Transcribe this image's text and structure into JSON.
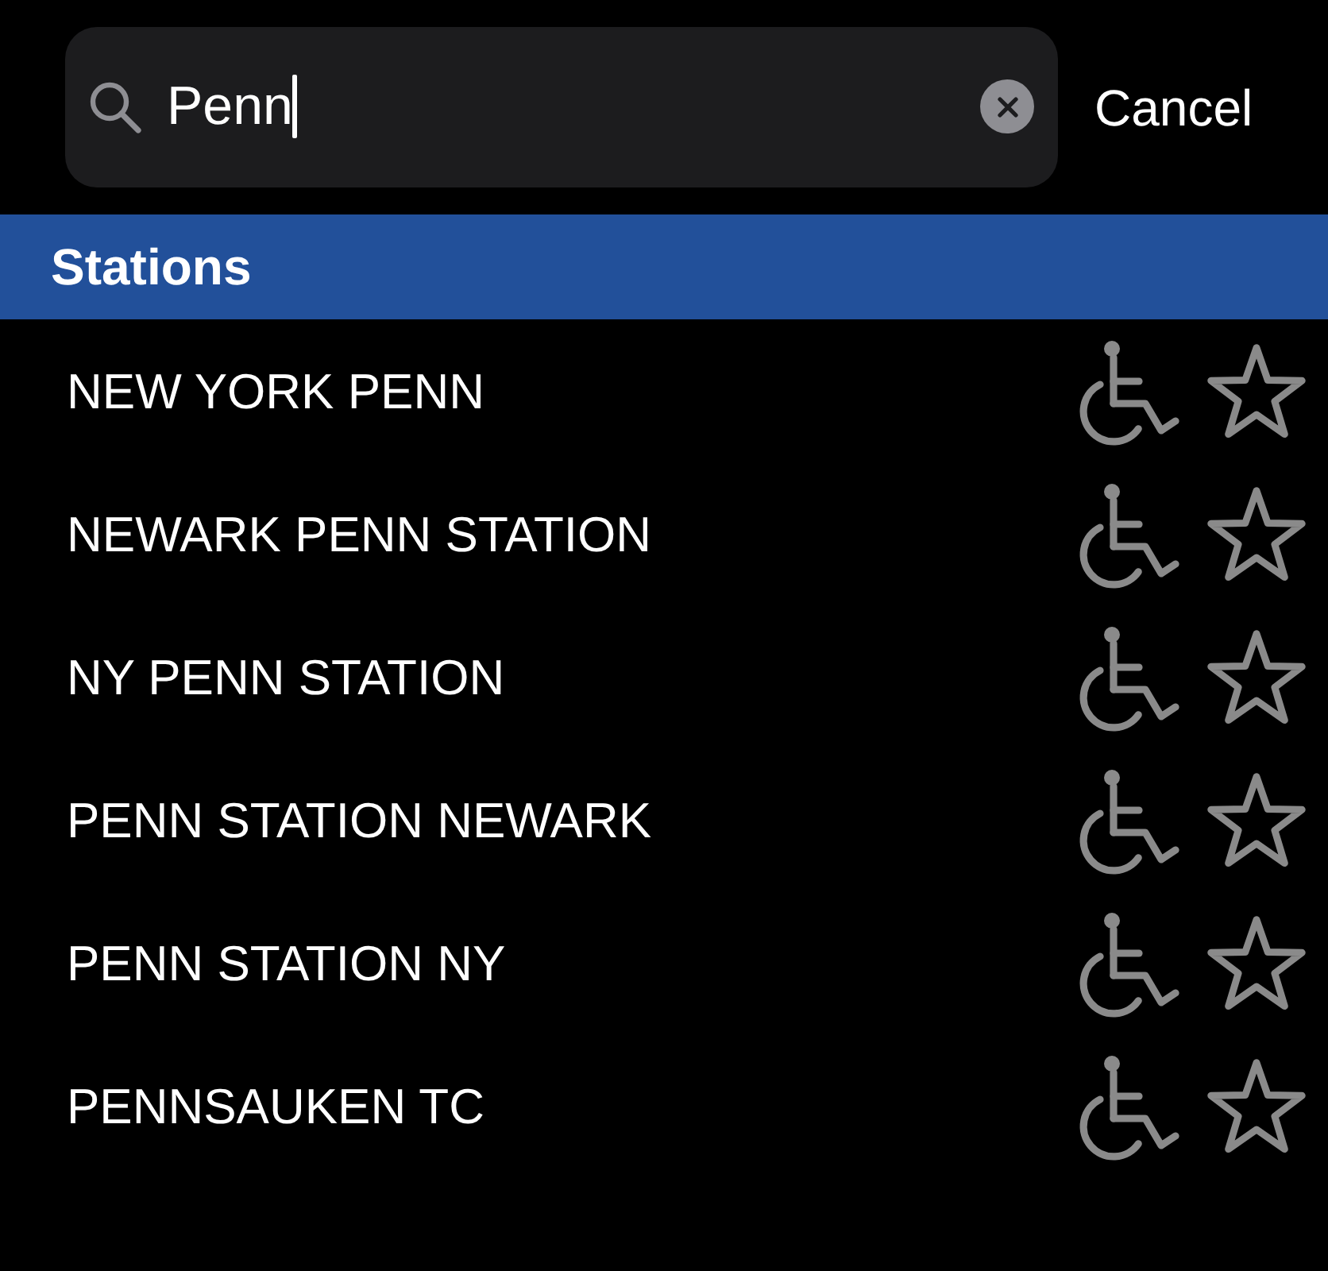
{
  "search": {
    "value": "Penn",
    "focused": true
  },
  "cancel": "Cancel",
  "section": {
    "title": "Stations"
  },
  "stations": [
    {
      "name": "NEW YORK PENN",
      "accessible": true,
      "favorite": false
    },
    {
      "name": "NEWARK PENN STATION",
      "accessible": true,
      "favorite": false
    },
    {
      "name": "NY PENN STATION",
      "accessible": true,
      "favorite": false
    },
    {
      "name": "PENN STATION NEWARK",
      "accessible": true,
      "favorite": false
    },
    {
      "name": "PENN STATION NY",
      "accessible": true,
      "favorite": false
    },
    {
      "name": "PENNSAUKEN TC",
      "accessible": true,
      "favorite": false
    }
  ]
}
